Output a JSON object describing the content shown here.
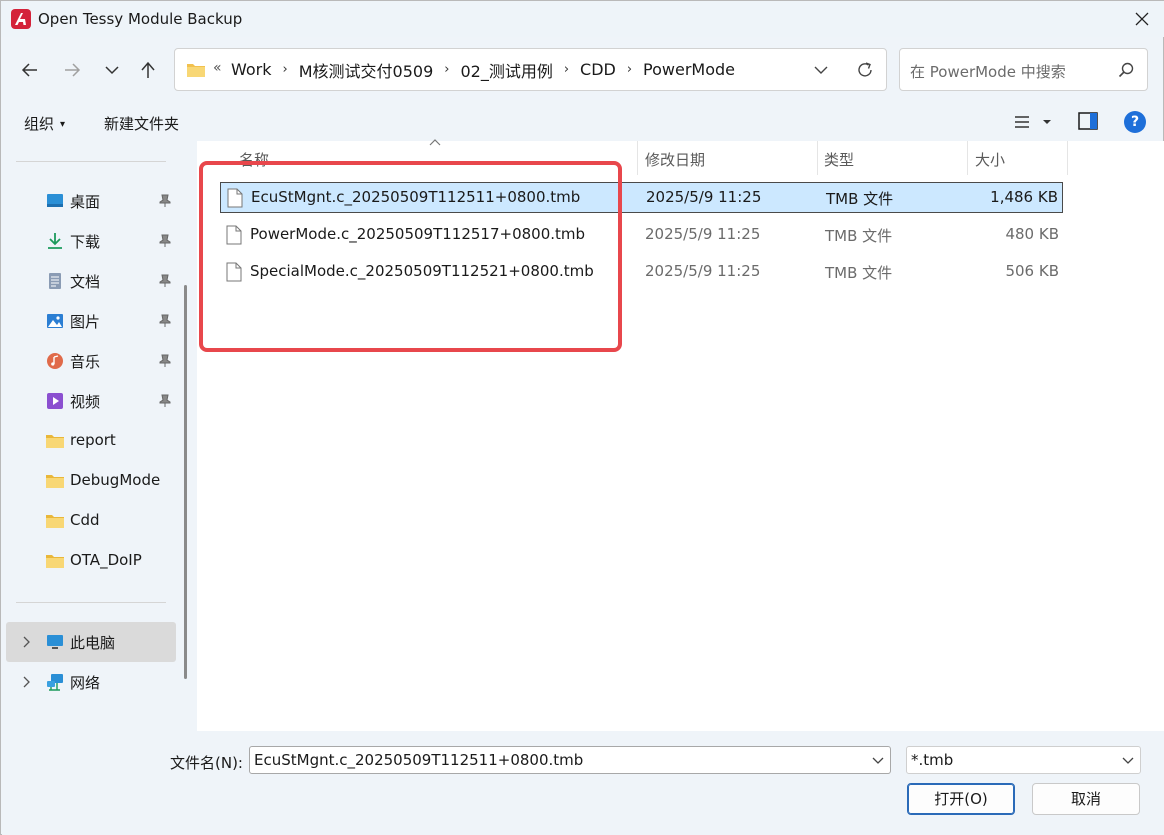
{
  "window": {
    "title": "Open Tessy Module Backup"
  },
  "address": {
    "overflow": "«",
    "crumbs": [
      "Work",
      "M核测试交付0509",
      "02_测试用例",
      "CDD",
      "PowerMode"
    ],
    "separator": "›"
  },
  "search": {
    "placeholder": "在 PowerMode 中搜索"
  },
  "commands": {
    "organize": "组织",
    "organize_caret": "▾",
    "new_folder": "新建文件夹",
    "help": "?"
  },
  "sidebar": {
    "quick_access": [
      {
        "label": "桌面",
        "icon": "desktop-icon",
        "pinned": true
      },
      {
        "label": "下载",
        "icon": "download-icon",
        "pinned": true
      },
      {
        "label": "文档",
        "icon": "document-icon",
        "pinned": true
      },
      {
        "label": "图片",
        "icon": "pictures-icon",
        "pinned": true
      },
      {
        "label": "音乐",
        "icon": "music-icon",
        "pinned": true
      },
      {
        "label": "视频",
        "icon": "video-icon",
        "pinned": true
      },
      {
        "label": "report",
        "icon": "folder-icon",
        "pinned": false
      },
      {
        "label": "DebugMode",
        "icon": "folder-icon",
        "pinned": false
      },
      {
        "label": "Cdd",
        "icon": "folder-icon",
        "pinned": false
      },
      {
        "label": "OTA_DoIP",
        "icon": "folder-icon",
        "pinned": false
      }
    ],
    "this_pc": "此电脑",
    "network": "网络"
  },
  "columns": {
    "name": "名称",
    "modified": "修改日期",
    "type": "类型",
    "size": "大小"
  },
  "files": [
    {
      "name": "EcuStMgnt.c_20250509T112511+0800.tmb",
      "modified": "2025/5/9 11:25",
      "type": "TMB 文件",
      "size": "1,486 KB",
      "selected": true
    },
    {
      "name": "PowerMode.c_20250509T112517+0800.tmb",
      "modified": "2025/5/9 11:25",
      "type": "TMB 文件",
      "size": "480 KB",
      "selected": false
    },
    {
      "name": "SpecialMode.c_20250509T112521+0800.tmb",
      "modified": "2025/5/9 11:25",
      "type": "TMB 文件",
      "size": "506 KB",
      "selected": false
    }
  ],
  "bottom": {
    "filename_label": "文件名(N):",
    "filename_value": "EcuStMgnt.c_20250509T112511+0800.tmb",
    "filetype_value": "*.tmb",
    "open_button": "打开(O)",
    "cancel_button": "取消"
  },
  "colors": {
    "selection": "#cce8ff",
    "highlight_box": "#e8474c",
    "accent": "#1e6fd9",
    "app_icon": "#d4233a"
  }
}
